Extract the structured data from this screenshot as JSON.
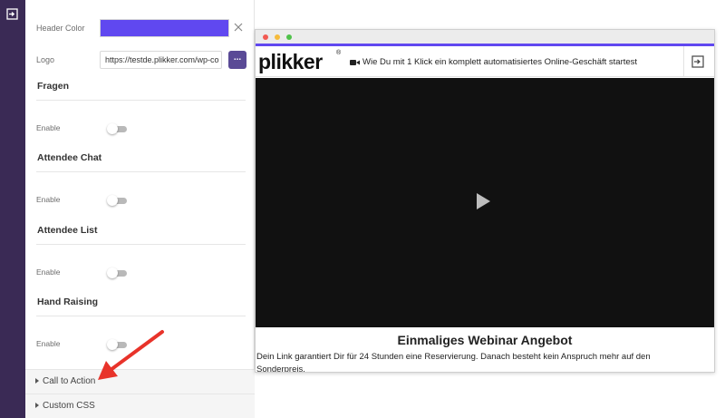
{
  "settings": {
    "header_color": {
      "label": "Header Color",
      "value": "#6048f0"
    },
    "logo": {
      "label": "Logo",
      "value": "https://testde.plikker.com/wp-co",
      "button": "..."
    },
    "sections": [
      {
        "title": "Fragen",
        "enable_label": "Enable",
        "enabled": false
      },
      {
        "title": "Attendee Chat",
        "enable_label": "Enable",
        "enabled": false
      },
      {
        "title": "Attendee List",
        "enable_label": "Enable",
        "enabled": false
      },
      {
        "title": "Hand Raising",
        "enable_label": "Enable",
        "enabled": false
      }
    ],
    "accordions": [
      {
        "label": "Call to Action"
      },
      {
        "label": "Custom CSS"
      }
    ]
  },
  "preview": {
    "brand_text": "plikker",
    "brand_reg": "®",
    "webinar_title": "Wie Du mit 1 Klick ein komplett automatisiertes Online-Geschäft startest",
    "offer_title": "Einmaliges Webinar Angebot",
    "offer_text": "Dein Link garantiert Dir für 24 Stunden eine Reservierung. Danach besteht kein Anspruch mehr auf den Sonderpreis."
  },
  "colors": {
    "sidebar_rail": "#3a2a55",
    "accent": "#6048f0",
    "annotation_arrow": "#e8332a",
    "video_bg": "#111111"
  },
  "icons": [
    "exit-icon",
    "close-icon",
    "toggle-switch",
    "caret-right-icon",
    "video-camera-icon",
    "play-icon",
    "annotation-arrow"
  ]
}
